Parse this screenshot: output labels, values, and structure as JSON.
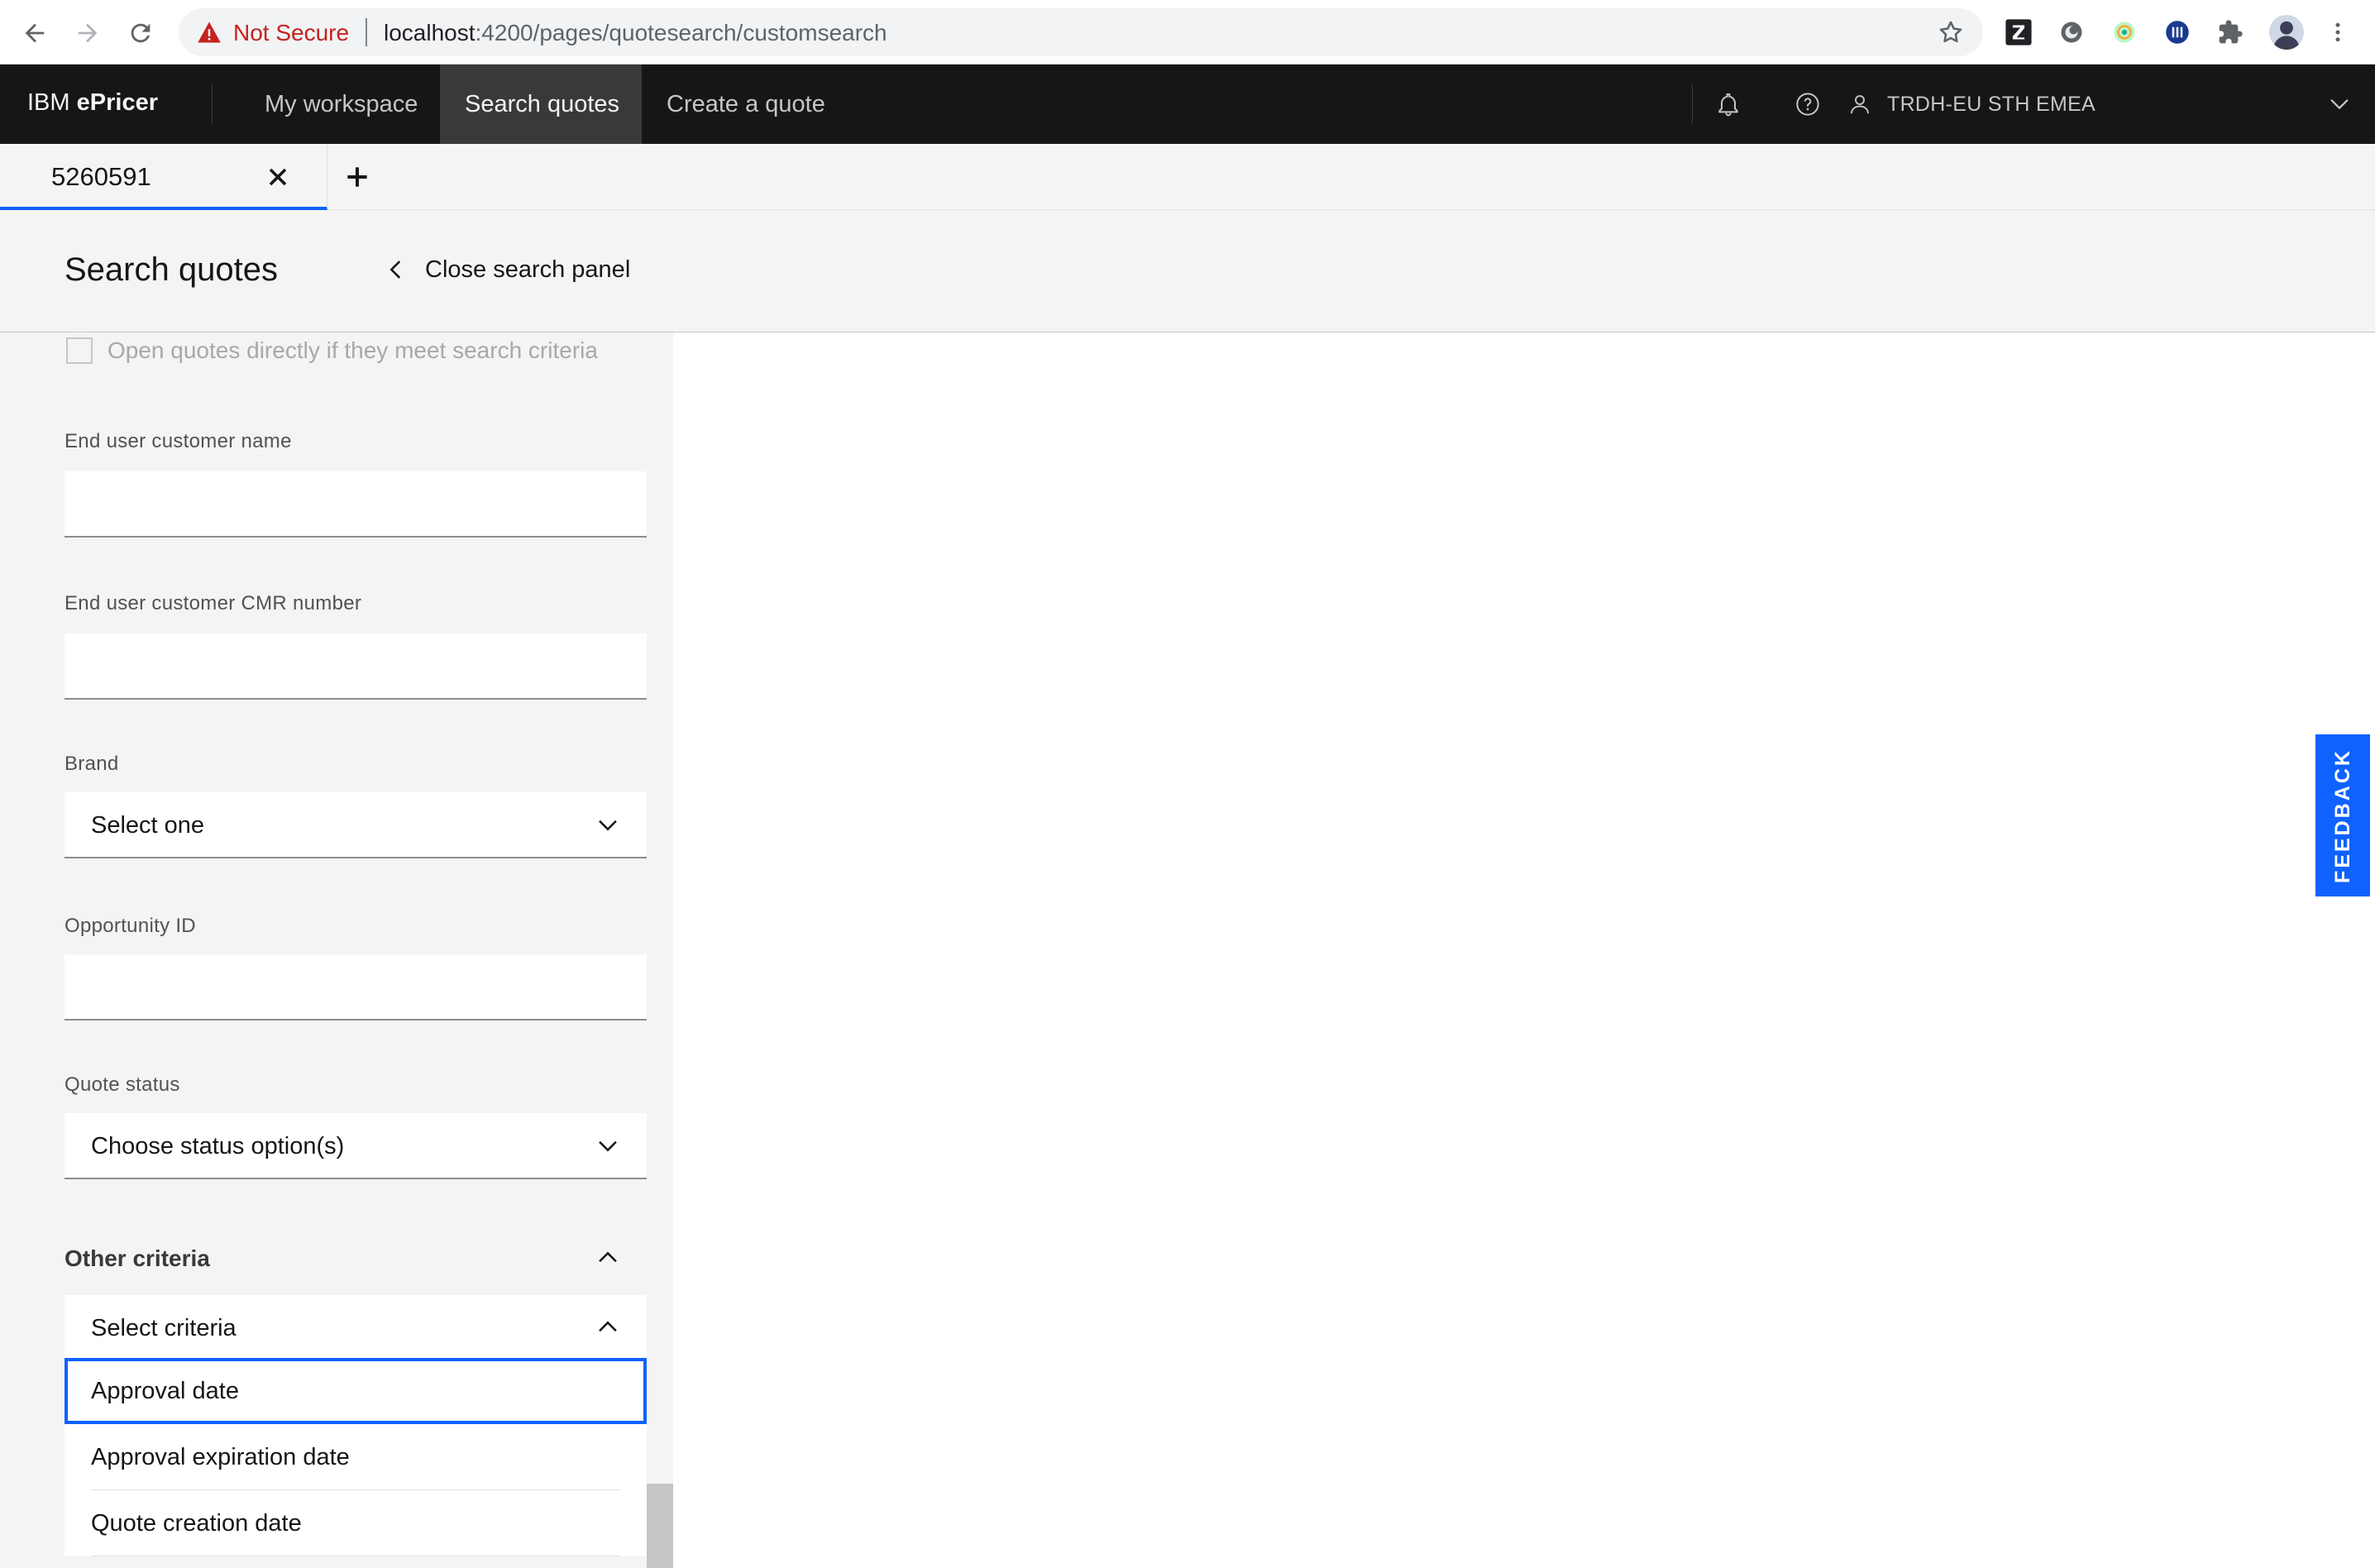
{
  "browser": {
    "security_label": "Not Secure",
    "url_host": "localhost",
    "url_path": ":4200/pages/quotesearch/customsearch",
    "icons": [
      "back-icon",
      "forward-icon",
      "reload-icon",
      "warning-icon",
      "star-icon",
      "zotero-icon",
      "extension-icon",
      "extension-icon",
      "extension-icon",
      "puzzle-icon",
      "avatar",
      "more-icon"
    ]
  },
  "header": {
    "brand_prefix": "IBM ",
    "brand_name": "ePricer",
    "nav": [
      {
        "label": "My workspace",
        "active": false
      },
      {
        "label": "Search quotes",
        "active": true
      },
      {
        "label": "Create a quote",
        "active": false
      }
    ],
    "user_label": "TRDH-EU STH EMEA"
  },
  "tabs": {
    "items": [
      {
        "label": "5260591"
      }
    ]
  },
  "panel": {
    "title": "Search quotes",
    "close_label": "Close search panel"
  },
  "form": {
    "open_directly_label": "Open quotes directly if they meet search criteria",
    "end_user_name_label": "End user customer name",
    "end_user_name_value": "",
    "end_user_cmr_label": "End user customer CMR number",
    "end_user_cmr_value": "",
    "brand_label": "Brand",
    "brand_value": "Select one",
    "opportunity_label": "Opportunity ID",
    "opportunity_value": "",
    "quote_status_label": "Quote status",
    "quote_status_value": "Choose status option(s)",
    "other_criteria_title": "Other criteria",
    "criteria_select_value": "Select criteria",
    "criteria_options": [
      {
        "label": "Approval date",
        "selected": true
      },
      {
        "label": "Approval expiration date",
        "selected": false
      },
      {
        "label": "Quote creation date",
        "selected": false
      }
    ]
  },
  "feedback_label": "FEEDBACK",
  "colors": {
    "header_bg": "#161616",
    "accent": "#0f62fe",
    "panel_bg": "#f4f4f4",
    "warning": "#c5221f"
  }
}
